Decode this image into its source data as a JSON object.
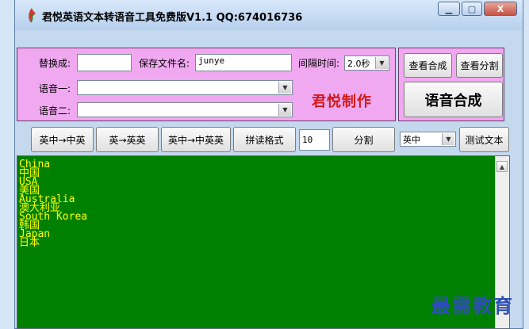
{
  "window": {
    "title": "君悦英语文本转语音工具免费版V1.1  QQ:674016736",
    "controls": {
      "minimize": "▁",
      "maximize": "▢",
      "close": "X"
    }
  },
  "form": {
    "replace_label": "替换成:",
    "replace_value": "",
    "save_label": "保存文件名:",
    "save_value": "junye",
    "interval_label": "间隔时间:",
    "interval_value": "2.0秒",
    "voice1_label": "语音一:",
    "voice1_value": "",
    "voice2_label": "语音二:",
    "voice2_value": "",
    "brand_label": "君悦制作"
  },
  "side": {
    "view_synth": "查看合成",
    "view_split": "查看分割",
    "synthesize": "语音合成"
  },
  "toolbar": {
    "btn_cn_en_cn": "英中→中英",
    "btn_en_en": "英→英英",
    "btn_cn_cn_en": "英中→中英英",
    "btn_format": "拼读格式",
    "count_value": "10",
    "btn_split": "分割",
    "lang_value": "英中",
    "btn_test": "测试文本"
  },
  "text_lines": [
    "China",
    "中国",
    "USA",
    "美国",
    "Australia",
    "澳大利亚",
    "South Korea",
    "韩国",
    "Japan",
    "日本"
  ],
  "watermark": "最需教育",
  "colors": {
    "panel_pink": "#f0a8f0",
    "text_bg": "#008000",
    "text_fg": "#ffff00",
    "brand_red": "#d21a1a"
  }
}
